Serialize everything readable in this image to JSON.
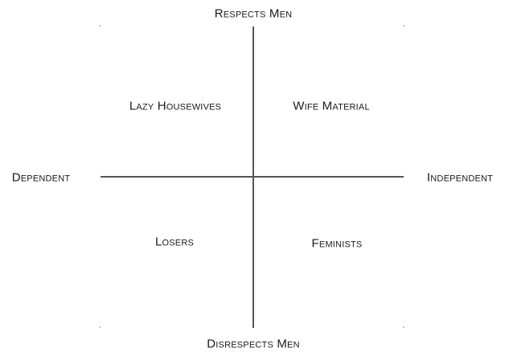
{
  "axes": {
    "top": "Respects Men",
    "bottom": "Disrespects Men",
    "left": "Dependent",
    "right": "Independent"
  },
  "quadrants": {
    "top_left": "Lazy Housewives",
    "top_right": "Wife Material",
    "bottom_left": "Losers",
    "bottom_right": "Feminists"
  },
  "colors": {
    "axis_line": "#555555",
    "text": "#1a1a1a",
    "background": "#ffffff"
  }
}
